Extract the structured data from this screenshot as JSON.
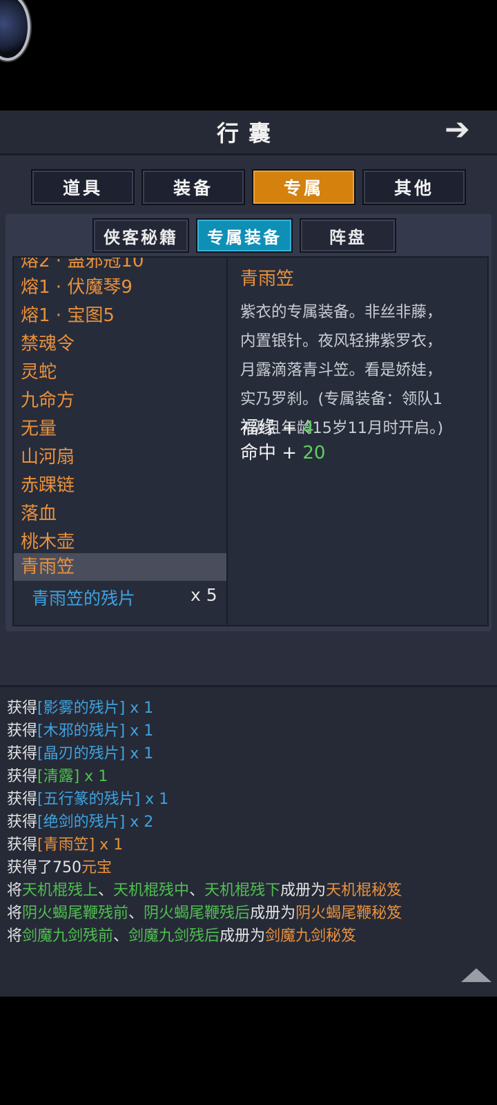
{
  "title": "行囊",
  "tabs": [
    "道具",
    "装备",
    "专属",
    "其他"
  ],
  "active_tab": "专属",
  "subtabs": [
    "侠客秘籍",
    "专属装备",
    "阵盘"
  ],
  "active_subtab": "专属装备",
  "list": {
    "partial_top": "熔2 · 蛊邪冠10",
    "items": [
      "熔1 · 伏魔琴9",
      "熔1 · 宝图5",
      "禁魂令",
      "灵蛇",
      "九命方",
      "无量",
      "山河扇",
      "赤踝链",
      "落血",
      "桃木壶",
      "青雨笠"
    ],
    "selected": "青雨笠",
    "fragment": {
      "name": "青雨笠的残片",
      "count": "x 5"
    }
  },
  "detail": {
    "name": "青雨笠",
    "description": [
      "紫衣的专属装备。非丝非藤，",
      "内置银针。夜风轻拂紫罗衣，",
      "月露滴落青斗笠。看是娇娃，",
      "实乃罗刹。(专属装备：领队1",
      "7级且年龄15岁11月时开启。)"
    ],
    "stats": [
      {
        "name": "福缘",
        "op": "+",
        "value": "4"
      },
      {
        "name": "命中",
        "op": "+",
        "value": "20"
      }
    ]
  },
  "log": [
    {
      "p": "获得",
      "item": "[影雾的残片]",
      "q": " x 1",
      "color": "b"
    },
    {
      "p": "获得",
      "item": "[木邪的残片]",
      "q": " x 1",
      "color": "b"
    },
    {
      "p": "获得",
      "item": "[晶刃的残片]",
      "q": " x 1",
      "color": "b"
    },
    {
      "p": "获得",
      "item": "[清露]",
      "q": " x 1",
      "color": "g"
    },
    {
      "p": "获得",
      "item": "[五行篆的残片]",
      "q": " x 1",
      "color": "b"
    },
    {
      "p": "获得",
      "item": "[绝剑的残片]",
      "q": " x 2",
      "color": "b"
    },
    {
      "p": "获得",
      "item": "[青雨笠]",
      "q": " x 1",
      "color": "o"
    },
    {
      "p": "获得了750",
      "item": "元宝",
      "q": "",
      "color": "o"
    }
  ],
  "log_combine": [
    {
      "a": "天机棍残上",
      "b": "天机棍残中",
      "c": "天机棍残下",
      "result": "天机棍秘笈"
    },
    {
      "a": "阴火蝎尾鞭残前",
      "b": "阴火蝎尾鞭残后",
      "c": null,
      "result": "阴火蝎尾鞭秘笈"
    },
    {
      "a": "剑魔九剑残前",
      "b": "剑魔九剑残后",
      "c": null,
      "result": "剑魔九剑秘笈"
    }
  ],
  "log_words": {
    "prefix": "将",
    "sep": "、",
    "mid": "成册为"
  }
}
